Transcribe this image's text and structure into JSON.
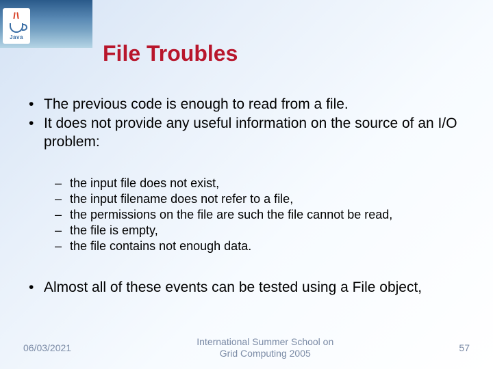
{
  "logo": {
    "text": "Java"
  },
  "title": "File Troubles",
  "bullets": [
    "The previous code is enough to read from a file.",
    "It does not provide any useful information on the source of an I/O problem:"
  ],
  "subbullets": [
    "the input file does not exist,",
    "the input filename does not refer to a file,",
    "the permissions on the file are such the file cannot be read,",
    "the file is empty,",
    "the file contains not enough data."
  ],
  "bullets2": [
    "Almost all of these events can be tested using a File object,"
  ],
  "footer": {
    "date": "06/03/2021",
    "center_line1": "International Summer School on",
    "center_line2": "Grid Computing 2005",
    "page": "57"
  }
}
